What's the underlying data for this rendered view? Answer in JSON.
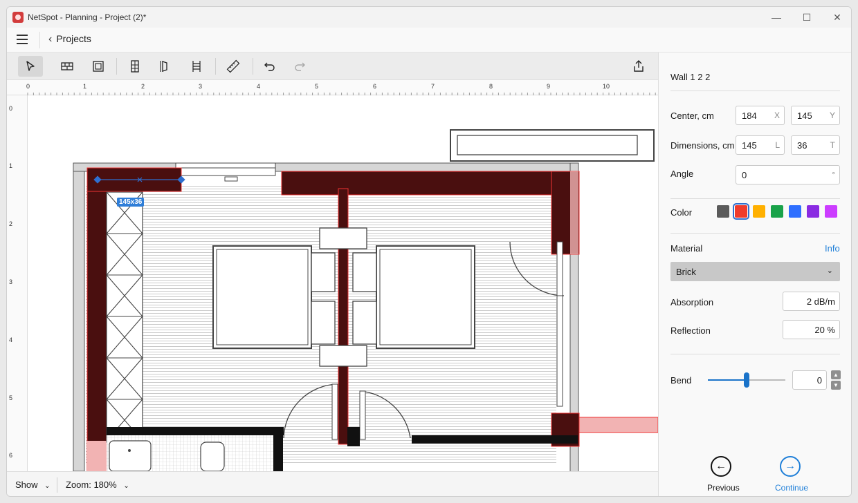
{
  "window": {
    "title": "NetSpot - Planning - Project (2)*",
    "min": "—",
    "max": "☐",
    "close": "✕"
  },
  "nav": {
    "back_label": "Projects"
  },
  "ruler": {
    "top": [
      "0",
      "1",
      "2",
      "3",
      "4",
      "5",
      "6",
      "7",
      "8",
      "9",
      "10"
    ],
    "left": [
      "0",
      "1",
      "2",
      "3",
      "4",
      "5",
      "6"
    ]
  },
  "canvas": {
    "dimension_badge": "145x36"
  },
  "status": {
    "show_label": "Show",
    "zoom_label": "Zoom: 180%"
  },
  "panel": {
    "title": "Wall 1 2 2",
    "center_label": "Center, cm",
    "center_x": "184",
    "center_x_unit": "X",
    "center_y": "145",
    "center_y_unit": "Y",
    "dimensions_label": "Dimensions, cm",
    "dim_l": "145",
    "dim_l_unit": "L",
    "dim_t": "36",
    "dim_t_unit": "T",
    "angle_label": "Angle",
    "angle_value": "0",
    "angle_unit": "°",
    "color_label": "Color",
    "colors": [
      "#5b5b5b",
      "#ef3b2c",
      "#ffb000",
      "#1aa34a",
      "#2f6fff",
      "#8a2be2",
      "#cc3dff"
    ],
    "selected_color_index": 1,
    "material_label": "Material",
    "info_label": "Info",
    "material_value": "Brick",
    "absorption_label": "Absorption",
    "absorption_value": "2 dB/m",
    "reflection_label": "Reflection",
    "reflection_value": "20 %",
    "bend_label": "Bend",
    "bend_value": "0",
    "bend_slider_fraction": 0.5,
    "previous_label": "Previous",
    "continue_label": "Continue"
  },
  "icons": {
    "select": "pointer-arrow-icon",
    "wall": "wall-brick-icon",
    "room": "room-icon",
    "door": "door-icon",
    "window_tool": "window-icon",
    "stairs": "stairs-icon",
    "measure": "ruler-icon",
    "undo": "undo-icon",
    "redo": "redo-icon",
    "share": "share-icon"
  }
}
